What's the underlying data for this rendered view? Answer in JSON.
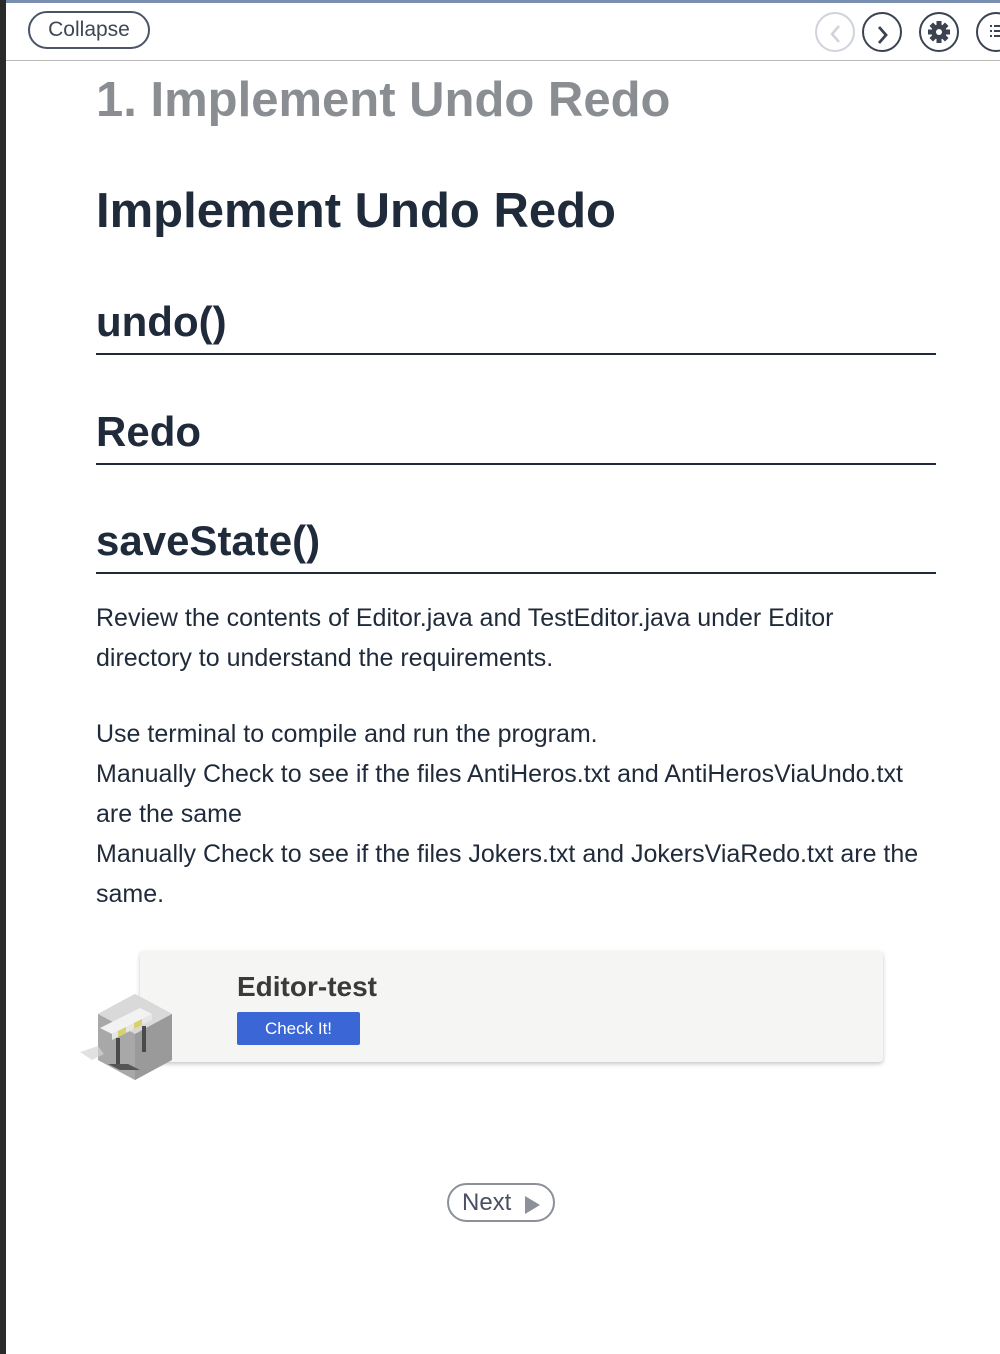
{
  "toolbar": {
    "collapse_label": "Collapse",
    "icons": [
      "chevron-left-icon",
      "chevron-right-icon",
      "gear-icon",
      "list-icon"
    ]
  },
  "page": {
    "title": "1. Implement Undo Redo"
  },
  "content": {
    "heading": "Implement Undo Redo",
    "subheadings": [
      "undo()",
      "Redo",
      "saveState()"
    ],
    "paragraph1": "Review the contents of Editor.java and TestEditor.java under Editor directory to understand the requirements.",
    "lines": [
      "Use terminal to compile and run the program.",
      "Manually Check to see if the files AntiHeros.txt and AntiHerosViaUndo.txt are the same",
      "Manually Check to see if the files Jokers.txt and JokersViaRedo.txt are the same."
    ]
  },
  "test_card": {
    "title": "Editor-test",
    "button_label": "Check It!",
    "icon": "test-barrier-icon"
  },
  "navigation": {
    "next_label": "Next"
  },
  "colors": {
    "heading": "#1f2a3a",
    "title_gray": "#8a8d92",
    "button_blue": "#3b67d6",
    "card_bg": "#f5f5f4"
  }
}
